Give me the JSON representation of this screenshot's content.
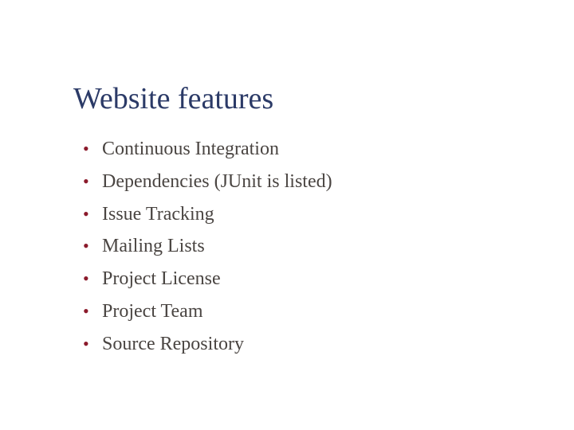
{
  "slide": {
    "title": "Website features",
    "bullet_glyph": "•",
    "items": [
      {
        "label": "Continuous Integration"
      },
      {
        "label": "Dependencies (JUnit is listed)"
      },
      {
        "label": "Issue Tracking"
      },
      {
        "label": "Mailing Lists"
      },
      {
        "label": "Project License"
      },
      {
        "label": "Project Team"
      },
      {
        "label": "Source Repository"
      }
    ],
    "colors": {
      "title": "#2b3a67",
      "bullet": "#8b1a2b",
      "text": "#4a4542",
      "background": "#ffffff"
    }
  }
}
